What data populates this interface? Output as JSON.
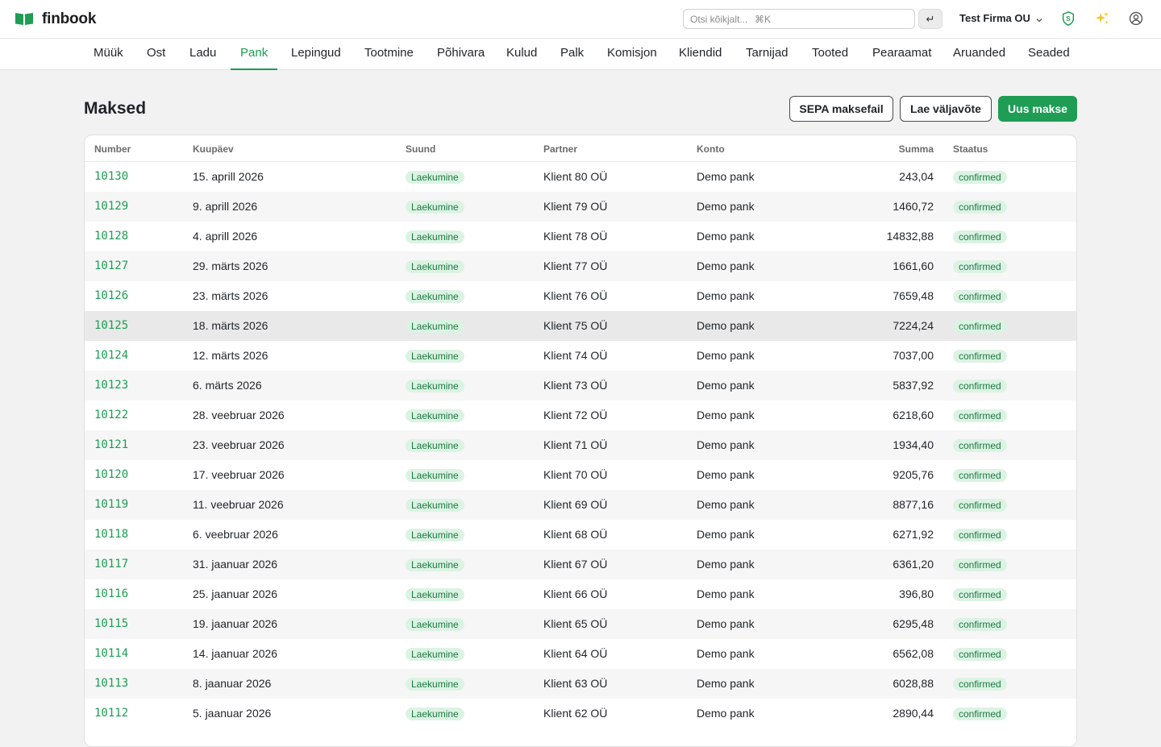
{
  "app": {
    "name": "finbook"
  },
  "search": {
    "placeholder": "Otsi kõikjalt...",
    "shortcut": "⌘K",
    "enter_label": "↵"
  },
  "company": {
    "name": "Test Firma OU"
  },
  "colors": {
    "brand": "#1f9d55",
    "link": "#1a9e52",
    "badge_bg": "#dcf3e4"
  },
  "nav": {
    "tabs": [
      {
        "label": "Müük",
        "active": false
      },
      {
        "label": "Ost",
        "active": false
      },
      {
        "label": "Ladu",
        "active": false
      },
      {
        "label": "Pank",
        "active": true
      },
      {
        "label": "Lepingud",
        "active": false
      },
      {
        "label": "Tootmine",
        "active": false
      },
      {
        "label": "Põhivara",
        "active": false
      },
      {
        "label": "Kulud",
        "active": false
      },
      {
        "label": "Palk",
        "active": false
      },
      {
        "label": "Komisjon",
        "active": false
      },
      {
        "label": "Kliendid",
        "active": false
      },
      {
        "label": "Tarnijad",
        "active": false
      },
      {
        "label": "Tooted",
        "active": false
      },
      {
        "label": "Pearaamat",
        "active": false
      },
      {
        "label": "Aruanded",
        "active": false
      },
      {
        "label": "Seaded",
        "active": false
      }
    ]
  },
  "page": {
    "title": "Maksed",
    "actions": {
      "sepa": "SEPA maksefail",
      "statement": "Lae väljavõte",
      "new_payment": "Uus makse"
    }
  },
  "table": {
    "columns": {
      "number": "Number",
      "date": "Kuupäev",
      "direction": "Suund",
      "partner": "Partner",
      "account": "Konto",
      "amount": "Summa",
      "status": "Staatus"
    },
    "rows": [
      {
        "number": "10130",
        "date": "15. aprill 2026",
        "direction": "Laekumine",
        "partner": "Klient 80 OÜ",
        "account": "Demo pank",
        "amount": "243,04",
        "status": "confirmed"
      },
      {
        "number": "10129",
        "date": "9. aprill 2026",
        "direction": "Laekumine",
        "partner": "Klient 79 OÜ",
        "account": "Demo pank",
        "amount": "1460,72",
        "status": "confirmed"
      },
      {
        "number": "10128",
        "date": "4. aprill 2026",
        "direction": "Laekumine",
        "partner": "Klient 78 OÜ",
        "account": "Demo pank",
        "amount": "14832,88",
        "status": "confirmed"
      },
      {
        "number": "10127",
        "date": "29. märts 2026",
        "direction": "Laekumine",
        "partner": "Klient 77 OÜ",
        "account": "Demo pank",
        "amount": "1661,60",
        "status": "confirmed"
      },
      {
        "number": "10126",
        "date": "23. märts 2026",
        "direction": "Laekumine",
        "partner": "Klient 76 OÜ",
        "account": "Demo pank",
        "amount": "7659,48",
        "status": "confirmed"
      },
      {
        "number": "10125",
        "date": "18. märts 2026",
        "direction": "Laekumine",
        "partner": "Klient 75 OÜ",
        "account": "Demo pank",
        "amount": "7224,24",
        "status": "confirmed"
      },
      {
        "number": "10124",
        "date": "12. märts 2026",
        "direction": "Laekumine",
        "partner": "Klient 74 OÜ",
        "account": "Demo pank",
        "amount": "7037,00",
        "status": "confirmed"
      },
      {
        "number": "10123",
        "date": "6. märts 2026",
        "direction": "Laekumine",
        "partner": "Klient 73 OÜ",
        "account": "Demo pank",
        "amount": "5837,92",
        "status": "confirmed"
      },
      {
        "number": "10122",
        "date": "28. veebruar 2026",
        "direction": "Laekumine",
        "partner": "Klient 72 OÜ",
        "account": "Demo pank",
        "amount": "6218,60",
        "status": "confirmed"
      },
      {
        "number": "10121",
        "date": "23. veebruar 2026",
        "direction": "Laekumine",
        "partner": "Klient 71 OÜ",
        "account": "Demo pank",
        "amount": "1934,40",
        "status": "confirmed"
      },
      {
        "number": "10120",
        "date": "17. veebruar 2026",
        "direction": "Laekumine",
        "partner": "Klient 70 OÜ",
        "account": "Demo pank",
        "amount": "9205,76",
        "status": "confirmed"
      },
      {
        "number": "10119",
        "date": "11. veebruar 2026",
        "direction": "Laekumine",
        "partner": "Klient 69 OÜ",
        "account": "Demo pank",
        "amount": "8877,16",
        "status": "confirmed"
      },
      {
        "number": "10118",
        "date": "6. veebruar 2026",
        "direction": "Laekumine",
        "partner": "Klient 68 OÜ",
        "account": "Demo pank",
        "amount": "6271,92",
        "status": "confirmed"
      },
      {
        "number": "10117",
        "date": "31. jaanuar 2026",
        "direction": "Laekumine",
        "partner": "Klient 67 OÜ",
        "account": "Demo pank",
        "amount": "6361,20",
        "status": "confirmed"
      },
      {
        "number": "10116",
        "date": "25. jaanuar 2026",
        "direction": "Laekumine",
        "partner": "Klient 66 OÜ",
        "account": "Demo pank",
        "amount": "396,80",
        "status": "confirmed"
      },
      {
        "number": "10115",
        "date": "19. jaanuar 2026",
        "direction": "Laekumine",
        "partner": "Klient 65 OÜ",
        "account": "Demo pank",
        "amount": "6295,48",
        "status": "confirmed"
      },
      {
        "number": "10114",
        "date": "14. jaanuar 2026",
        "direction": "Laekumine",
        "partner": "Klient 64 OÜ",
        "account": "Demo pank",
        "amount": "6562,08",
        "status": "confirmed"
      },
      {
        "number": "10113",
        "date": "8. jaanuar 2026",
        "direction": "Laekumine",
        "partner": "Klient 63 OÜ",
        "account": "Demo pank",
        "amount": "6028,88",
        "status": "confirmed"
      },
      {
        "number": "10112",
        "date": "5. jaanuar 2026",
        "direction": "Laekumine",
        "partner": "Klient 62 OÜ",
        "account": "Demo pank",
        "amount": "2890,44",
        "status": "confirmed"
      }
    ]
  }
}
